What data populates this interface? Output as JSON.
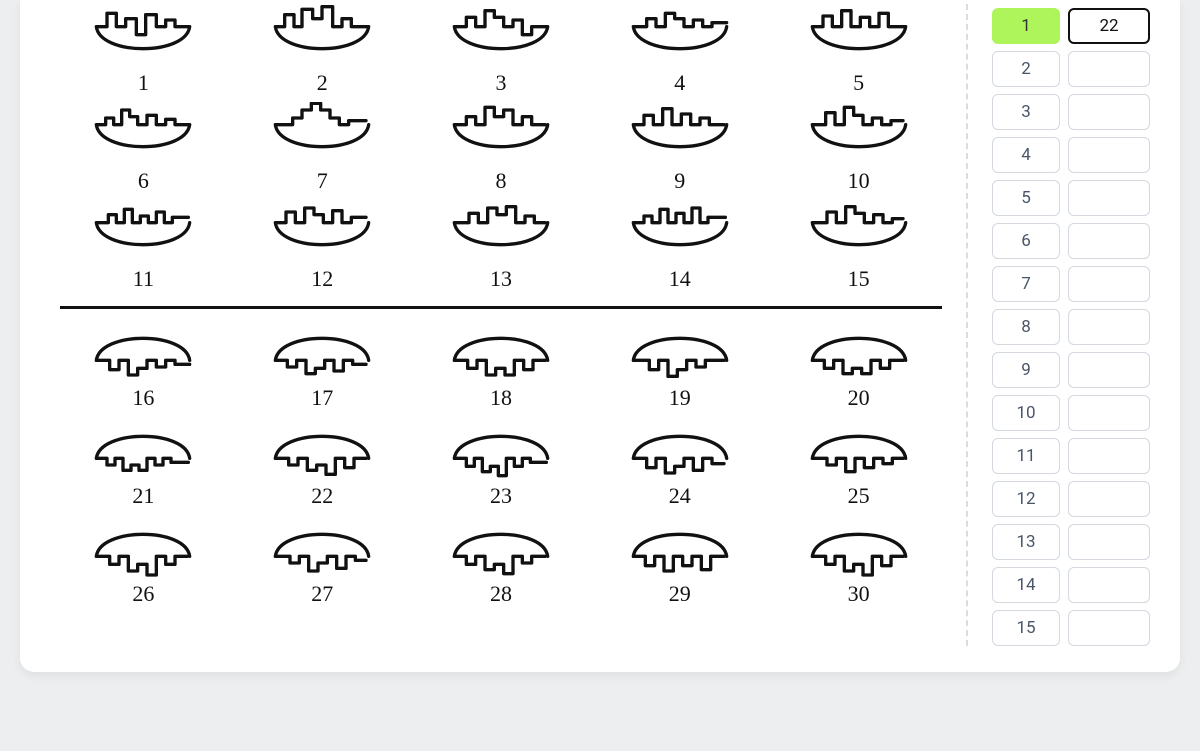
{
  "puzzle": {
    "top_labels": [
      "1",
      "2",
      "3",
      "4",
      "5",
      "6",
      "7",
      "8",
      "9",
      "10",
      "11",
      "12",
      "13",
      "14",
      "15"
    ],
    "bottom_labels": [
      "16",
      "17",
      "18",
      "19",
      "20",
      "21",
      "22",
      "23",
      "24",
      "25",
      "26",
      "27",
      "28",
      "29",
      "30"
    ]
  },
  "answers": {
    "rows": [
      {
        "n": "1",
        "val": "22",
        "highlight": true,
        "active": true
      },
      {
        "n": "2",
        "val": "",
        "highlight": false,
        "active": false
      },
      {
        "n": "3",
        "val": "",
        "highlight": false,
        "active": false
      },
      {
        "n": "4",
        "val": "",
        "highlight": false,
        "active": false
      },
      {
        "n": "5",
        "val": "",
        "highlight": false,
        "active": false
      },
      {
        "n": "6",
        "val": "",
        "highlight": false,
        "active": false
      },
      {
        "n": "7",
        "val": "",
        "highlight": false,
        "active": false
      },
      {
        "n": "8",
        "val": "",
        "highlight": false,
        "active": false
      },
      {
        "n": "9",
        "val": "",
        "highlight": false,
        "active": false
      },
      {
        "n": "10",
        "val": "",
        "highlight": false,
        "active": false
      },
      {
        "n": "11",
        "val": "",
        "highlight": false,
        "active": false
      },
      {
        "n": "12",
        "val": "",
        "highlight": false,
        "active": false
      },
      {
        "n": "13",
        "val": "",
        "highlight": false,
        "active": false
      },
      {
        "n": "14",
        "val": "",
        "highlight": false,
        "active": false
      },
      {
        "n": "15",
        "val": "",
        "highlight": false,
        "active": false
      }
    ]
  }
}
